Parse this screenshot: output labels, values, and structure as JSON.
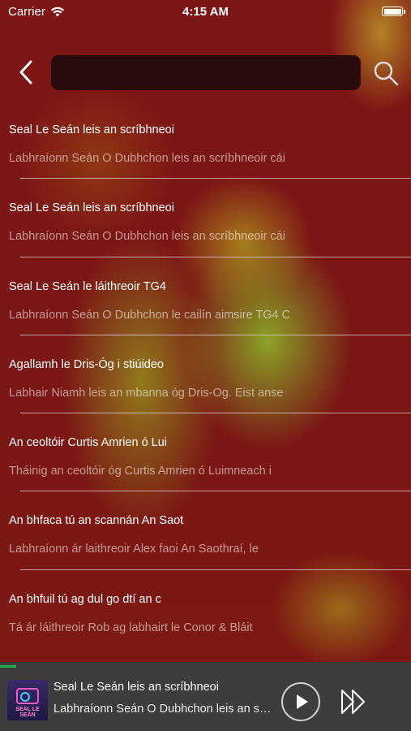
{
  "status_bar": {
    "carrier": "Carrier",
    "time": "4:15 AM"
  },
  "search": {
    "value": "",
    "placeholder": ""
  },
  "episodes": [
    {
      "title": "Seal Le Seán leis an scríbhneoi",
      "subtitle": "Labhraíonn Seán O Dubhchon leis an scríbhneoir cái"
    },
    {
      "title": "Seal Le Seán leis an scríbhneoi",
      "subtitle": "Labhraíonn Seán O Dubhchon leis an scríbhneoir cái"
    },
    {
      "title": "Seal Le Seán le láithreoir TG4",
      "subtitle": "Labhraíonn Seán O Dubhchon le cailín aimsire TG4 C"
    },
    {
      "title": "Agallamh le Dris-Óg i stiúideo",
      "subtitle": "Labhair Niamh leis an mbanna óg Dris-Og.  Eist anse"
    },
    {
      "title": "An ceoltóir Curtis Amrien ó Lui",
      "subtitle": "Tháinig an ceoltóir óg Curtis Amrien ó Luimneach i"
    },
    {
      "title": "An bhfaca tú an scannán An Saot",
      "subtitle": "Labhraíonn ár laithreoir Alex faoi An Saothraí, le"
    },
    {
      "title": "An bhfuil tú ag dul go dtí an c",
      "subtitle": "Tá ár láithreoir Rob ag labhairt le Conor & Bláit"
    }
  ],
  "player": {
    "title": "Seal Le Seán leis an scríbhneoi",
    "subtitle": "Labhraíonn Seán O Dubhchon leis an scríbhneoir cáil",
    "artwork_text": "SEAL LE SEÁN",
    "progress": 0.04,
    "accent": "#22b14c"
  },
  "icons": {
    "back": "chevron-left-icon",
    "search": "magnifier-icon",
    "play": "play-icon",
    "forward": "fast-forward-icon",
    "wifi": "wifi-icon",
    "battery": "battery-icon"
  }
}
